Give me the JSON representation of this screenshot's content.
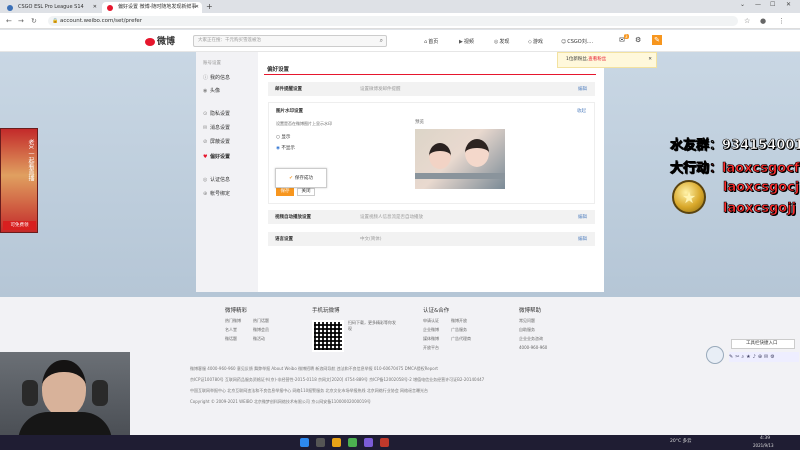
{
  "browser": {
    "tabs": [
      {
        "label": "CSGO ESL Pro League S14",
        "color": "#3b6fb6"
      },
      {
        "label": "偏好设置 微博-随时随地发现新鲜事",
        "color": "#e6162d"
      }
    ],
    "url": "account.weibo.com/set/prefer"
  },
  "header": {
    "logo": "微博",
    "search_placeholder": "大家正在搜：千元购买雪莲被治",
    "nav": [
      {
        "icon": "home-icon",
        "glyph": "⌂",
        "label": "首页"
      },
      {
        "icon": "video-icon",
        "glyph": "▶",
        "label": "视频"
      },
      {
        "icon": "discover-icon",
        "glyph": "◎",
        "label": "发现"
      },
      {
        "icon": "game-icon",
        "glyph": "◇",
        "label": "游戏"
      },
      {
        "icon": "user-icon",
        "glyph": "☺",
        "label": "CSGO刘...."
      }
    ],
    "mail_badge": "3",
    "accent": "#e6162d",
    "brand_orange": "#f7961e"
  },
  "notice": {
    "text": "1位新粉丝,",
    "link": "查看粉丝"
  },
  "sidebar": {
    "title": "账号设置",
    "items": [
      {
        "icon": "info-icon",
        "glyph": "ⓘ",
        "label": "我的信息"
      },
      {
        "icon": "avatar-icon",
        "glyph": "◉",
        "label": "头像"
      },
      {
        "icon": "privacy-icon",
        "glyph": "⊙",
        "label": "隐私设置"
      },
      {
        "icon": "message-icon",
        "glyph": "✉",
        "label": "消息设置"
      },
      {
        "icon": "block-icon",
        "glyph": "⊘",
        "label": "屏蔽设置"
      },
      {
        "icon": "prefer-icon",
        "glyph": "♥",
        "label": "偏好设置"
      },
      {
        "icon": "verify-icon",
        "glyph": "◎",
        "label": "认证信息"
      },
      {
        "icon": "bind-icon",
        "glyph": "⊕",
        "label": "帐号绑定"
      }
    ]
  },
  "main": {
    "title": "偏好设置",
    "rows": [
      {
        "label": "邮件提醒设置",
        "desc": "设置微博发邮件提醒",
        "edit": "编辑"
      },
      {
        "label": "视频自动播放设置",
        "desc": "设置视频人信息流是否自动播放",
        "edit": "编辑"
      },
      {
        "label": "语言设置",
        "desc": "中文(简体)",
        "edit": "编辑"
      }
    ],
    "watermark": {
      "title": "图片水印设置",
      "close": "收起",
      "hint": "设置是否在微博图片上显示水印",
      "options": [
        "显示",
        "不显示"
      ],
      "selected": "不显示",
      "preview_label": "预览",
      "save": "保存",
      "cancel": "关闭"
    },
    "toast": "保存成功"
  },
  "footer": {
    "columns": [
      {
        "title": "微博精彩",
        "links": [
          "热门微博",
          "热门话题",
          "名人堂",
          "微博会员",
          "微话题",
          "微活动"
        ]
      },
      {
        "title": "手机玩微博",
        "qr_text": "扫码下载，更多精彩等你发现"
      },
      {
        "title": "认证&合作",
        "links": [
          "申请认证",
          "微博开放",
          "企业微博",
          "广告服务",
          "媒体微博",
          "广告代理商",
          "开放平台"
        ]
      },
      {
        "title": "微博帮助",
        "links": [
          "常见问题",
          "自助服务",
          "企业业务咨询",
          "4000-960-960"
        ]
      }
    ],
    "lines": [
      "微博客服 4000-960-960  意见反馈  舞弊举报  About Weibo  微博招聘  新浪网导航  违法和不良信息举报 010-60670475  DMCA侵权Report",
      "京ICP证100780号  互联网药品服务资格证书(京)-非经营性-2015-0118  京网文[2020] 4754-889号  京ICP备12002058号-2  增值电信业务经营许可证B2-20140447",
      "中国互联网举报中心  北京互联网违法和不良信息举报中心  网络110报警服务  北京文化市场举报热线  北京网络行业协会  网络谣言曝光台",
      "Copyright © 2009-2021 WEIBO 北京微梦创科网络技术有限公司  京公网安备11000002000019号"
    ],
    "toolbar_label": "工具栏快捷入口"
  },
  "taskbar": {
    "weather": "20°C 多云",
    "time": "4:39",
    "date": "2021/9/13"
  },
  "overlay": {
    "qq_group": "水友群：934154001",
    "action_line1": "大行动：laoxcsgocf",
    "action_line2": "laoxcsgocj",
    "action_line3": "laoxcsgojj",
    "left_banner": "老X 一起看直播",
    "left_badge": "可免费领"
  }
}
